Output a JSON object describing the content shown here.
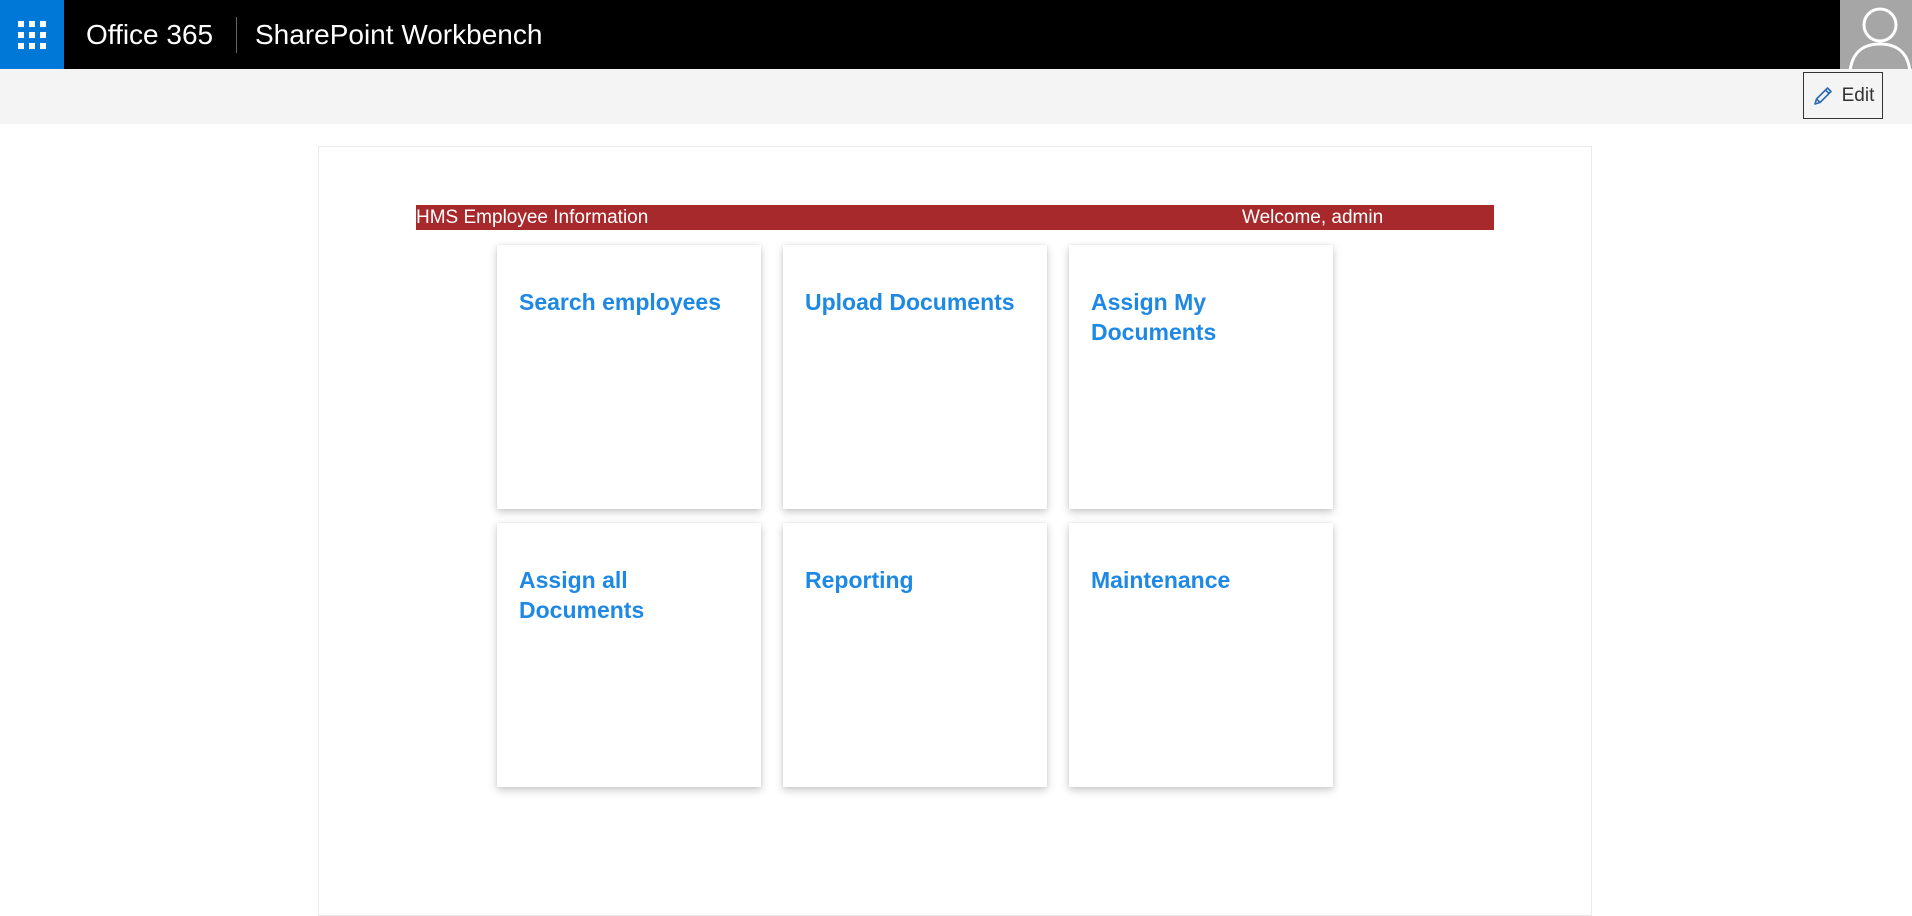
{
  "topbar": {
    "brand": "Office 365",
    "app_title": "SharePoint Workbench",
    "colors": {
      "background": "#000000",
      "app_launcher": "#0078d7"
    },
    "icons": {
      "app_launcher": "waffle-icon",
      "avatar": "user-avatar-icon"
    }
  },
  "command_bar": {
    "edit_label": "Edit",
    "edit_icon": "pencil-icon"
  },
  "webpart": {
    "header_title": "HMS Employee Information",
    "welcome_text": "Welcome, admin",
    "header_color": "#a8292b",
    "tile_text_color": "#1e88e5",
    "tiles": [
      {
        "label": "Search employees"
      },
      {
        "label": "Upload Documents"
      },
      {
        "label": "Assign My Documents"
      },
      {
        "label": "Assign all Documents"
      },
      {
        "label": "Reporting"
      },
      {
        "label": "Maintenance"
      }
    ]
  }
}
